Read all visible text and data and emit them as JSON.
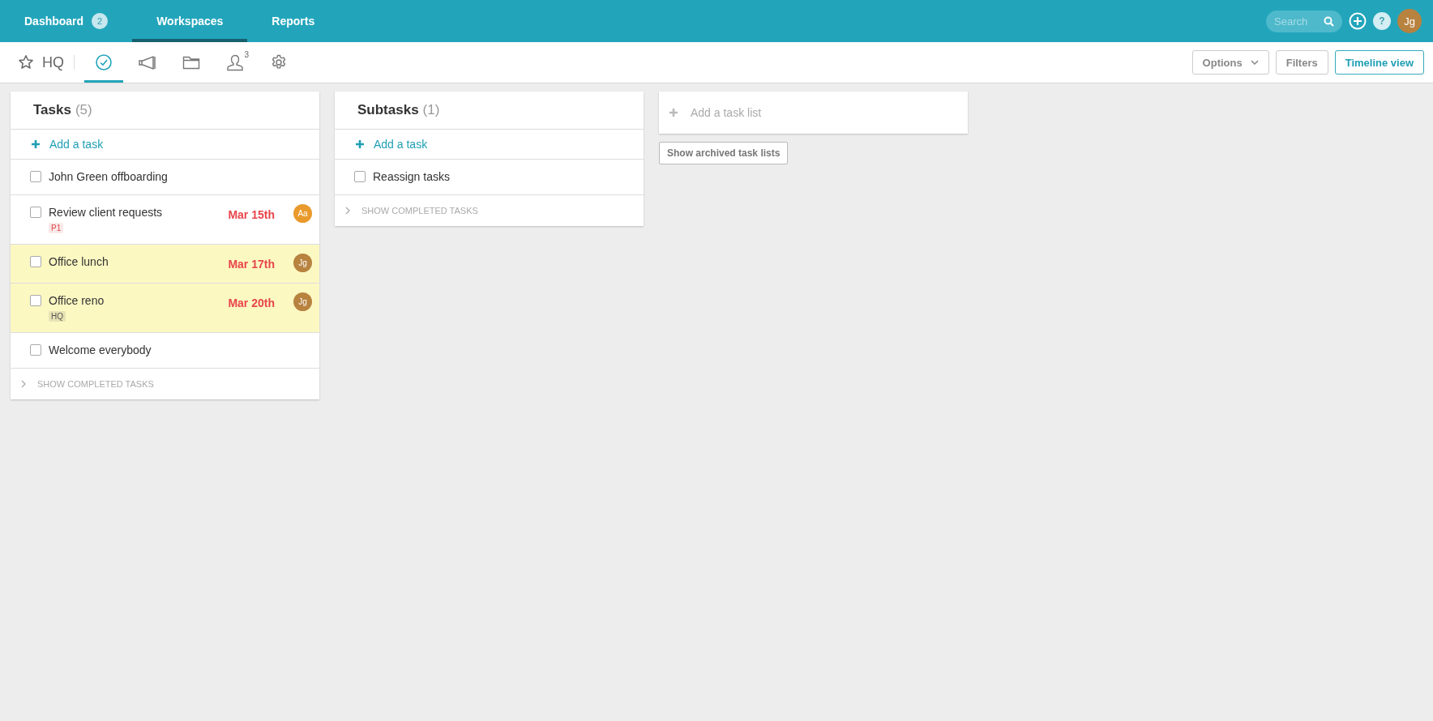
{
  "nav": {
    "tabs": [
      {
        "label": "Dashboard",
        "badge": "2",
        "selected": false
      },
      {
        "label": "Workspaces",
        "selected": true
      },
      {
        "label": "Reports",
        "selected": false
      }
    ],
    "search": {
      "placeholder": "Search"
    },
    "help": "?",
    "user": {
      "initials": "Jg",
      "color": "#b8823f"
    }
  },
  "toolbar": {
    "workspace": "HQ",
    "starred": false,
    "tabs": [
      {
        "kind": "tasks",
        "selected": true
      },
      {
        "kind": "announcements",
        "selected": false
      },
      {
        "kind": "files",
        "selected": false
      },
      {
        "kind": "members",
        "badge": "3",
        "selected": false
      },
      {
        "kind": "settings",
        "selected": false
      }
    ],
    "buttons": [
      {
        "label": "Options",
        "kind": "dropdown"
      },
      {
        "label": "Filters",
        "kind": "plain"
      },
      {
        "label": "Timeline view",
        "kind": "primary"
      }
    ]
  },
  "lists": [
    {
      "title": "Tasks",
      "count": "(5)",
      "add_label": "Add a task",
      "show_completed": "SHOW COMPLETED TASKS",
      "tasks": [
        {
          "name": "John Green offboarding",
          "checked": false,
          "highlighted": false
        },
        {
          "name": "Review client requests",
          "checked": false,
          "highlighted": false,
          "due": "Mar 15th",
          "assignee": {
            "initials": "Aa",
            "color": "#e99a2c"
          },
          "tags": [
            {
              "label": "P1",
              "color": "#e04848"
            }
          ]
        },
        {
          "name": "Office lunch",
          "checked": false,
          "highlighted": true,
          "due": "Mar 17th",
          "assignee": {
            "initials": "Jg",
            "color": "#b8823f"
          }
        },
        {
          "name": "Office reno",
          "checked": false,
          "highlighted": true,
          "due": "Mar 20th",
          "assignee": {
            "initials": "Jg",
            "color": "#b8823f"
          },
          "tags": [
            {
              "label": "HQ",
              "color": "#555555"
            }
          ]
        },
        {
          "name": "Welcome everybody",
          "checked": false,
          "highlighted": false
        }
      ]
    },
    {
      "title": "Subtasks",
      "count": "(1)",
      "add_label": "Add a task",
      "show_completed": "SHOW COMPLETED TASKS",
      "tasks": [
        {
          "name": "Reassign tasks",
          "checked": false,
          "highlighted": false
        }
      ]
    }
  ],
  "add_list": {
    "placeholder": "Add a task list"
  },
  "archived_button": "Show archived task lists"
}
